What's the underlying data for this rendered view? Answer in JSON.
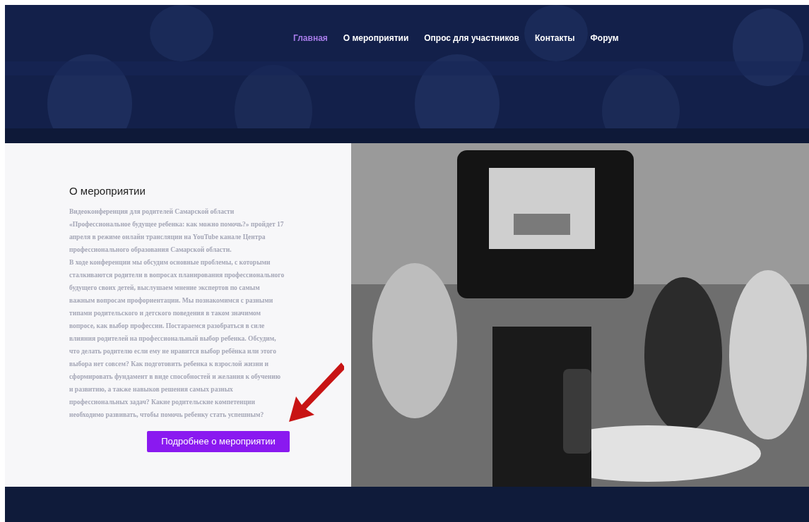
{
  "header": {
    "nav": [
      {
        "label": "Главная",
        "selected": true
      },
      {
        "label": "О мероприятии",
        "selected": false
      },
      {
        "label": "Опрос для участников",
        "selected": false
      },
      {
        "label": "Контакты",
        "selected": false
      },
      {
        "label": "Форум",
        "selected": false
      }
    ]
  },
  "about": {
    "title": "О мероприятии",
    "paragraphs": [
      "Видеоконференция для родителей Самарской области «Профессиональное будущее ребенка: как можно помочь?» пройдет 17 апреля в режиме онлайн трансляции на YouTube канале Центра профессионального образования Самарской области.",
      "В ходе конференции мы обсудим основные проблемы, с которыми сталкиваются родители в вопросах планирования профессионального будущего своих детей, выслушаем мнение экспертов по самым важным вопросам профориентации. Мы познакомимся с разными типами родительского и детского поведения в таком значимом вопросе, как выбор профессии. Постараемся разобраться в силе влияния родителей на профессиональный выбор ребенка. Обсудим, что делать родителю если ему не нравится выбор ребёнка или этого выбора нет совсем? Как подготовить ребенка к взрослой жизни и сформировать фундамент в виде способностей и желания к обучению и развитию, а также навыков решения самых разных профессиональных задач? Какие родительские компетенции необходимо развивать, чтобы помочь ребенку стать успешным?"
    ],
    "button": "Подробнее о мероприятии"
  }
}
